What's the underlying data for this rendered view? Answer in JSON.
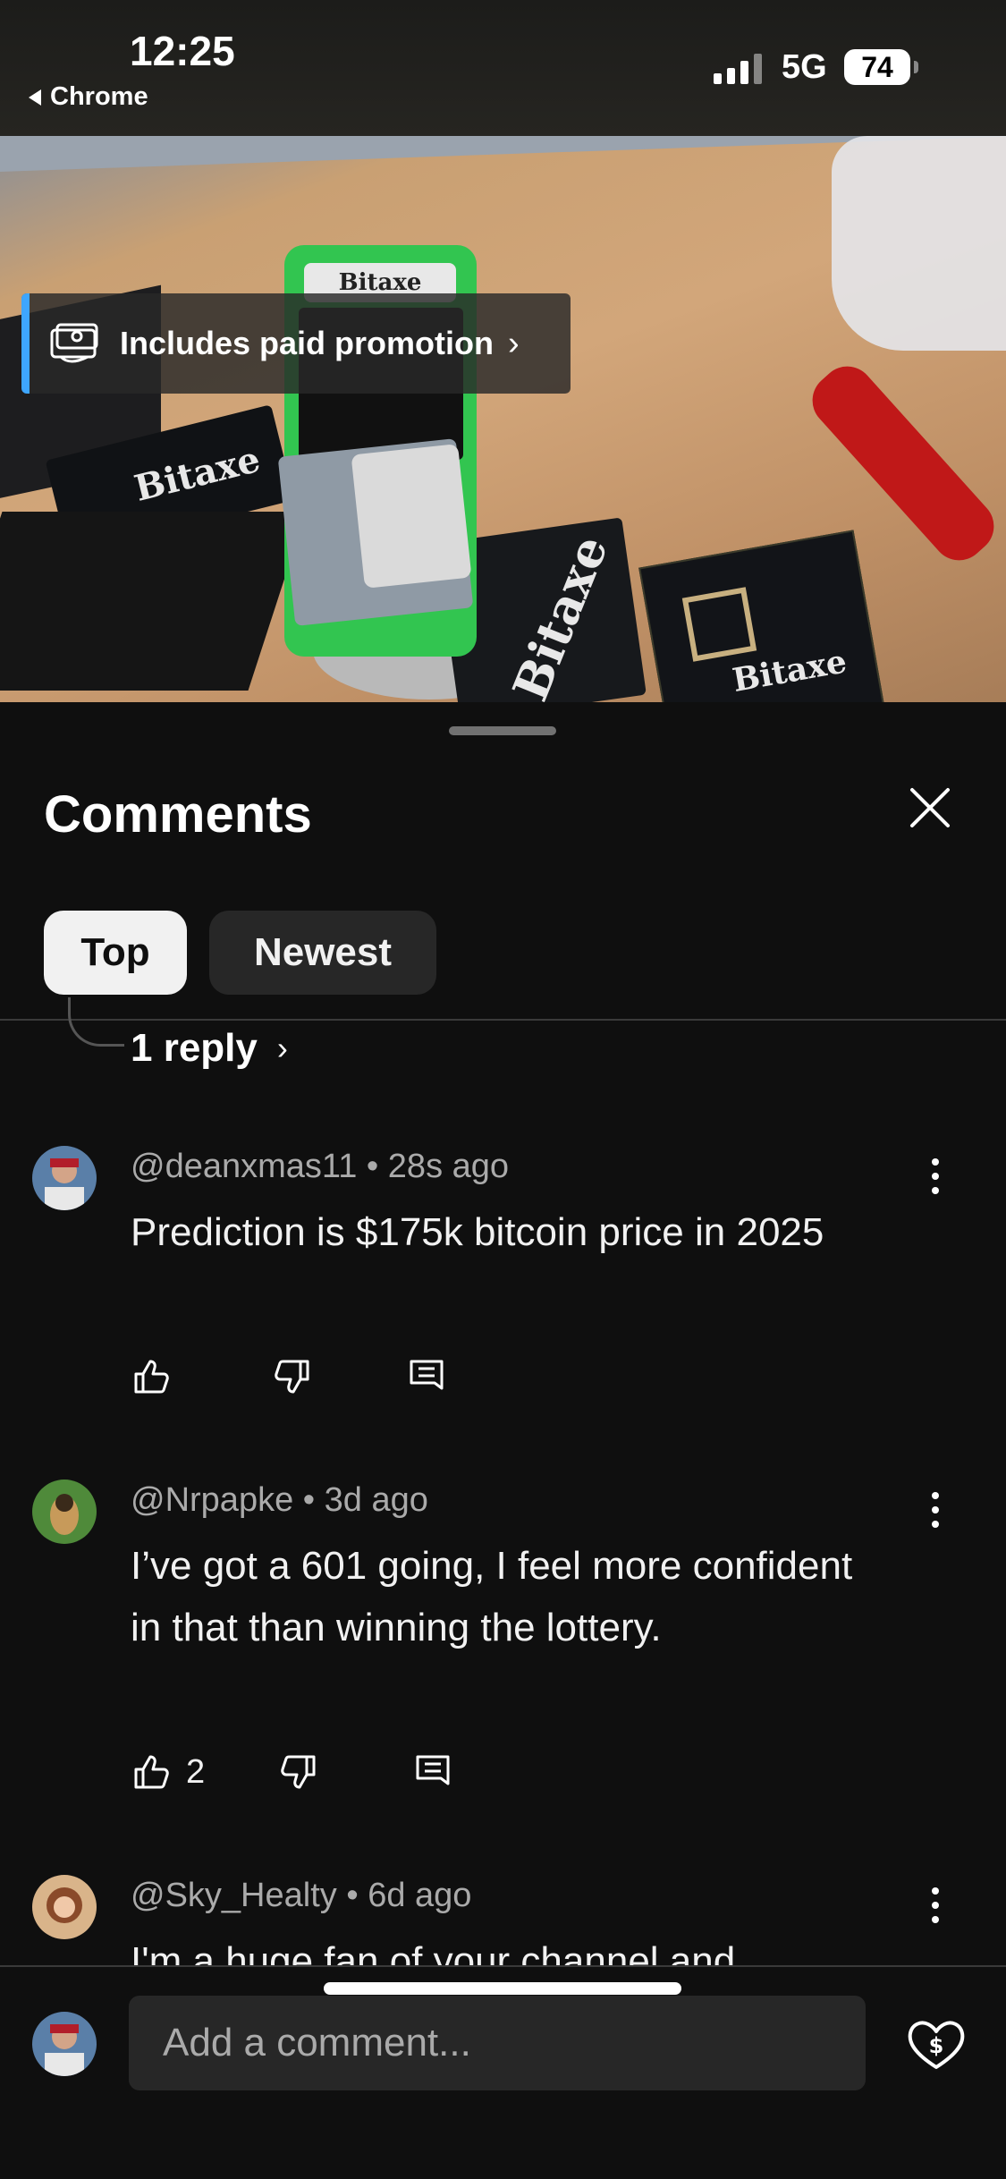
{
  "status_bar": {
    "time": "12:25",
    "back_app": "Chrome",
    "network": "5G",
    "battery": "74"
  },
  "video": {
    "promo_label": "Includes paid promotion",
    "brand_text": "Bitaxe"
  },
  "comments_sheet": {
    "title": "Comments",
    "tabs": [
      {
        "label": "Top",
        "selected": true
      },
      {
        "label": "Newest",
        "selected": false
      }
    ],
    "previous_thread_reply_link": "1 reply",
    "comments": [
      {
        "author": "@deanxmas11",
        "age": "28s ago",
        "text": "Prediction is $175k bitcoin price in 2025",
        "likes": ""
      },
      {
        "author": "@Nrpapke",
        "age": "3d ago",
        "text": "I’ve got a 601 going, I feel more confident in that than winning the lottery.",
        "likes": "2"
      },
      {
        "author": "@Sky_Healty",
        "age": "6d ago",
        "text": "I'm a huge fan of your channel and",
        "likes": ""
      }
    ],
    "meta_separator": "•",
    "add_comment_placeholder": "Add a comment...",
    "colors": {
      "background": "#0f0f0f",
      "chip_selected": "#f1f1f1",
      "chip_unselected": "#272727",
      "promo_accent": "#3ea6ff"
    }
  }
}
